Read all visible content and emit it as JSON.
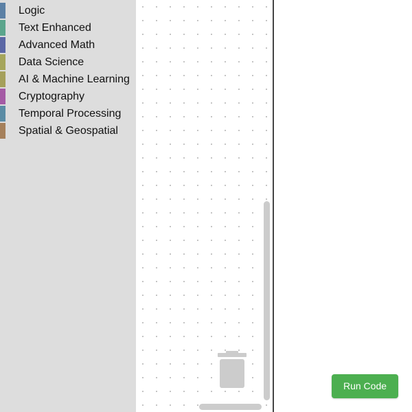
{
  "toolbox": {
    "categories": [
      {
        "label": "Logic",
        "color": "#5b80a5"
      },
      {
        "label": "Text Enhanced",
        "color": "#5ba58c"
      },
      {
        "label": "Advanced Math",
        "color": "#5b67a5"
      },
      {
        "label": "Data Science",
        "color": "#a5a55b"
      },
      {
        "label": "AI & Machine Learning",
        "color": "#a5a05b"
      },
      {
        "label": "Cryptography",
        "color": "#a55ba5"
      },
      {
        "label": "Temporal Processing",
        "color": "#5b8ca5"
      },
      {
        "label": "Spatial & Geospatial",
        "color": "#a5805b"
      }
    ]
  },
  "workspace": {
    "trash_icon": "trash-can-icon"
  },
  "actions": {
    "run_label": "Run Code",
    "run_color": "#4caf50"
  }
}
